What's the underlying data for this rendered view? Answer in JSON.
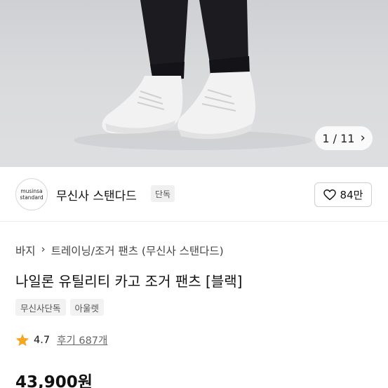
{
  "gallery": {
    "current": "1",
    "total": "11",
    "separator": " / "
  },
  "brand": {
    "logo_line1": "musinsa",
    "logo_line2": "standard",
    "name": "무신사 스탠다드",
    "badge": "단독",
    "likes": "84만"
  },
  "breadcrumb": {
    "category": "바지",
    "subcategory": "트레이닝/조거 팬츠 (무신사 스탠다드)"
  },
  "product": {
    "title": "나일론 유틸리티 카고 조거 팬츠 [블랙]",
    "tags": [
      "무신사단독",
      "아울렛"
    ],
    "rating": "4.7",
    "reviews": "후기 687개",
    "price": "43,900원"
  },
  "colors": {
    "star": "#f5a623",
    "pants": "#1c1c20",
    "shoe": "#f2f2f2"
  }
}
